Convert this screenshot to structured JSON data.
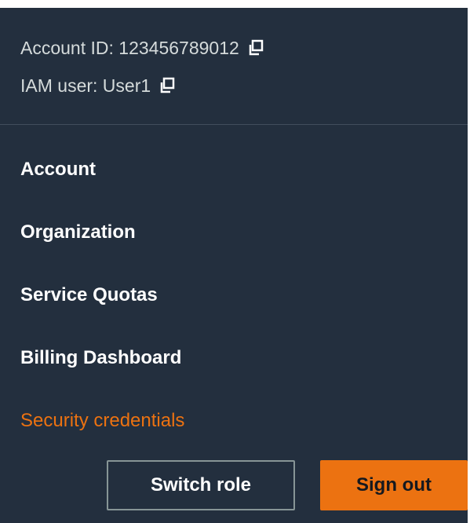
{
  "account": {
    "account_id_label": "Account ID: 123456789012",
    "iam_user_label": "IAM user: User1"
  },
  "menu": {
    "items": [
      {
        "label": "Account"
      },
      {
        "label": "Organization"
      },
      {
        "label": "Service Quotas"
      },
      {
        "label": "Billing Dashboard"
      },
      {
        "label": "Security credentials"
      }
    ]
  },
  "buttons": {
    "switch_role": "Switch role",
    "sign_out": "Sign out"
  },
  "colors": {
    "background": "#232f3e",
    "accent": "#ec7211",
    "text": "#ffffff",
    "muted_text": "#d5dbdb"
  },
  "icons": {
    "copy": "copy-icon"
  }
}
